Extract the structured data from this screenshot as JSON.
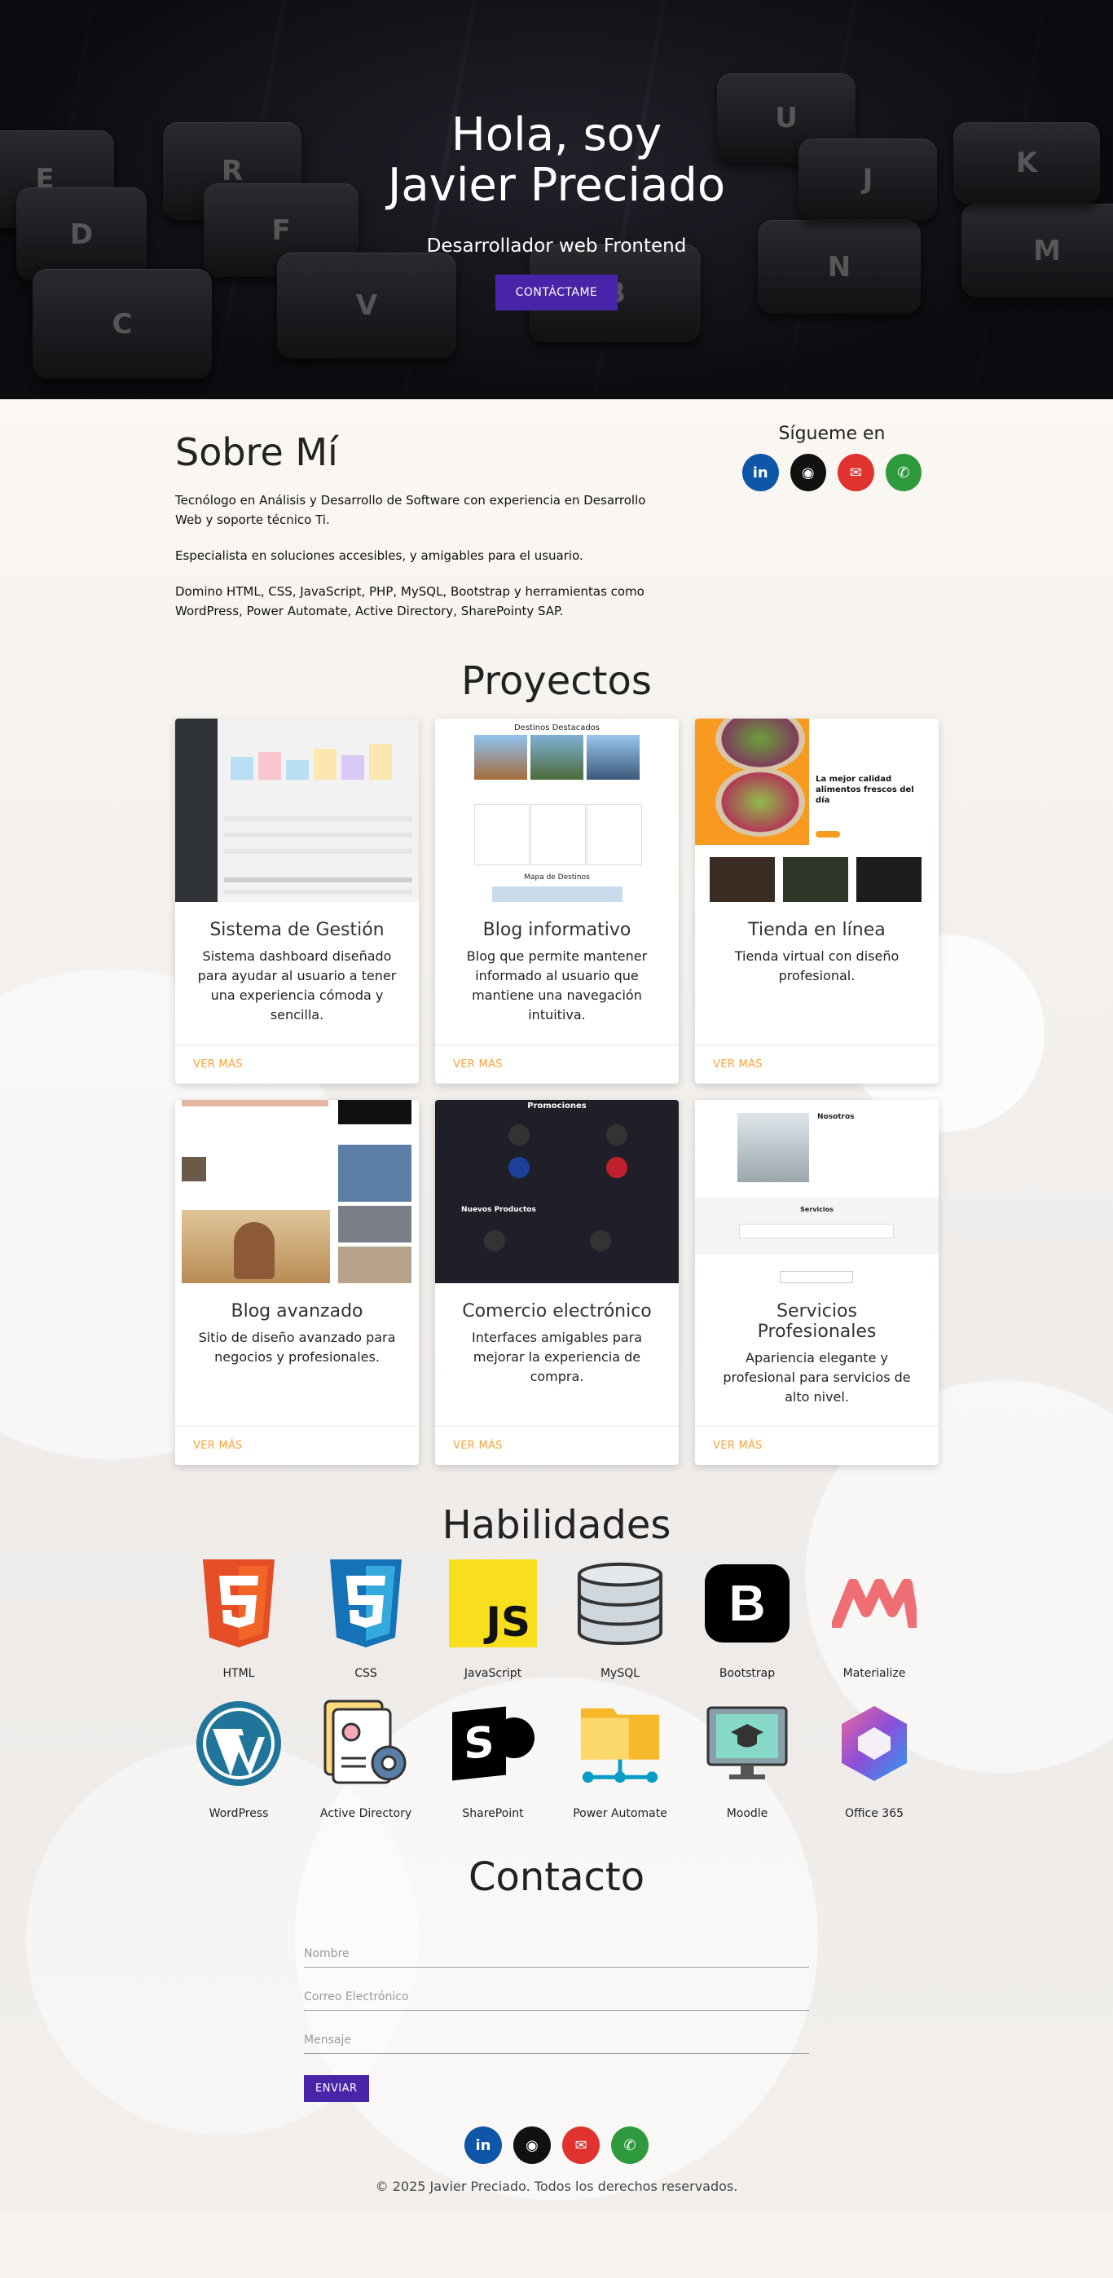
{
  "hero": {
    "title_line1": "Hola, soy",
    "title_line2": "Javier Preciado",
    "subtitle": "Desarrollador web Frontend",
    "button_label": "CONTÁCTAME",
    "keys": [
      "E",
      "R",
      "F",
      "D",
      "C",
      "V",
      "B",
      "N",
      "M",
      "U",
      "J",
      "K"
    ]
  },
  "about": {
    "title": "Sobre Mí",
    "paragraphs": [
      "Tecnólogo en Análisis y Desarrollo de Software con experiencia en Desarrollo Web y soporte técnico Ti.",
      "Especialista en soluciones accesibles, y amigables para el usuario.",
      "Domino HTML, CSS, JavaScript, PHP, MySQL, Bootstrap y herramientas como WordPress, Power Automate, Active Directory, SharePointy SAP."
    ],
    "follow_title": "Sígueme en"
  },
  "social": {
    "linkedin": "in",
    "github": "◉",
    "mail": "✉",
    "whatsapp": "✆"
  },
  "projects": {
    "title": "Proyectos",
    "link_label": "VER MÁS",
    "items": [
      {
        "title": "Sistema de Gestión",
        "text": "Sistema dashboard diseñado para ayudar al usuario a tener una experiencia cómoda y sencilla."
      },
      {
        "title": "Blog informativo",
        "text": "Blog que permite mantener informado al usuario que mantiene una navegación intuitiva."
      },
      {
        "title": "Tienda en línea",
        "text": "Tienda virtual con diseño profesional."
      },
      {
        "title": "Blog avanzado",
        "text": "Sitio de diseño avanzado para negocios y profesionales."
      },
      {
        "title": "Comercio electrónico",
        "text": "Interfaces amigables para mejorar la experiencia de compra."
      },
      {
        "title": "Servicios Profesionales",
        "text": "Apariencia elegante y profesional para servicios de alto nivel."
      }
    ],
    "thumb_texts": {
      "blog_heading": "Destinos Destacados",
      "blog_map": "Mapa de Destinos",
      "shop_heading": "La mejor calidad alimentos frescos del día",
      "ecom_heading": "Promociones",
      "ecom_sub": "Nuevos Productos",
      "serv_heading": "Nosotros",
      "serv_sub": "Servicios"
    }
  },
  "skills": {
    "title": "Habilidades",
    "items": [
      {
        "label": "HTML",
        "icon": "html5-icon"
      },
      {
        "label": "CSS",
        "icon": "css3-icon"
      },
      {
        "label": "JavaScript",
        "icon": "javascript-icon"
      },
      {
        "label": "MySQL",
        "icon": "database-icon"
      },
      {
        "label": "Bootstrap",
        "icon": "bootstrap-icon"
      },
      {
        "label": "Materialize",
        "icon": "materialize-icon"
      },
      {
        "label": "WordPress",
        "icon": "wordpress-icon"
      },
      {
        "label": "Active Directory",
        "icon": "active-directory-icon"
      },
      {
        "label": "SharePoint",
        "icon": "sharepoint-icon"
      },
      {
        "label": "Power Automate",
        "icon": "power-automate-icon"
      },
      {
        "label": "Moodle",
        "icon": "moodle-icon"
      },
      {
        "label": "Office 365",
        "icon": "office365-icon"
      }
    ],
    "badges": {
      "js": "JS",
      "bootstrap": "B",
      "sharepoint": "S"
    }
  },
  "contact": {
    "title": "Contacto",
    "name_placeholder": "Nombre",
    "email_placeholder": "Correo Electrónico",
    "message_placeholder": "Mensaje",
    "submit_label": "ENVIAR"
  },
  "footer": {
    "copyright": "© 2025 Javier Preciado. Todos los derechos reservados."
  }
}
